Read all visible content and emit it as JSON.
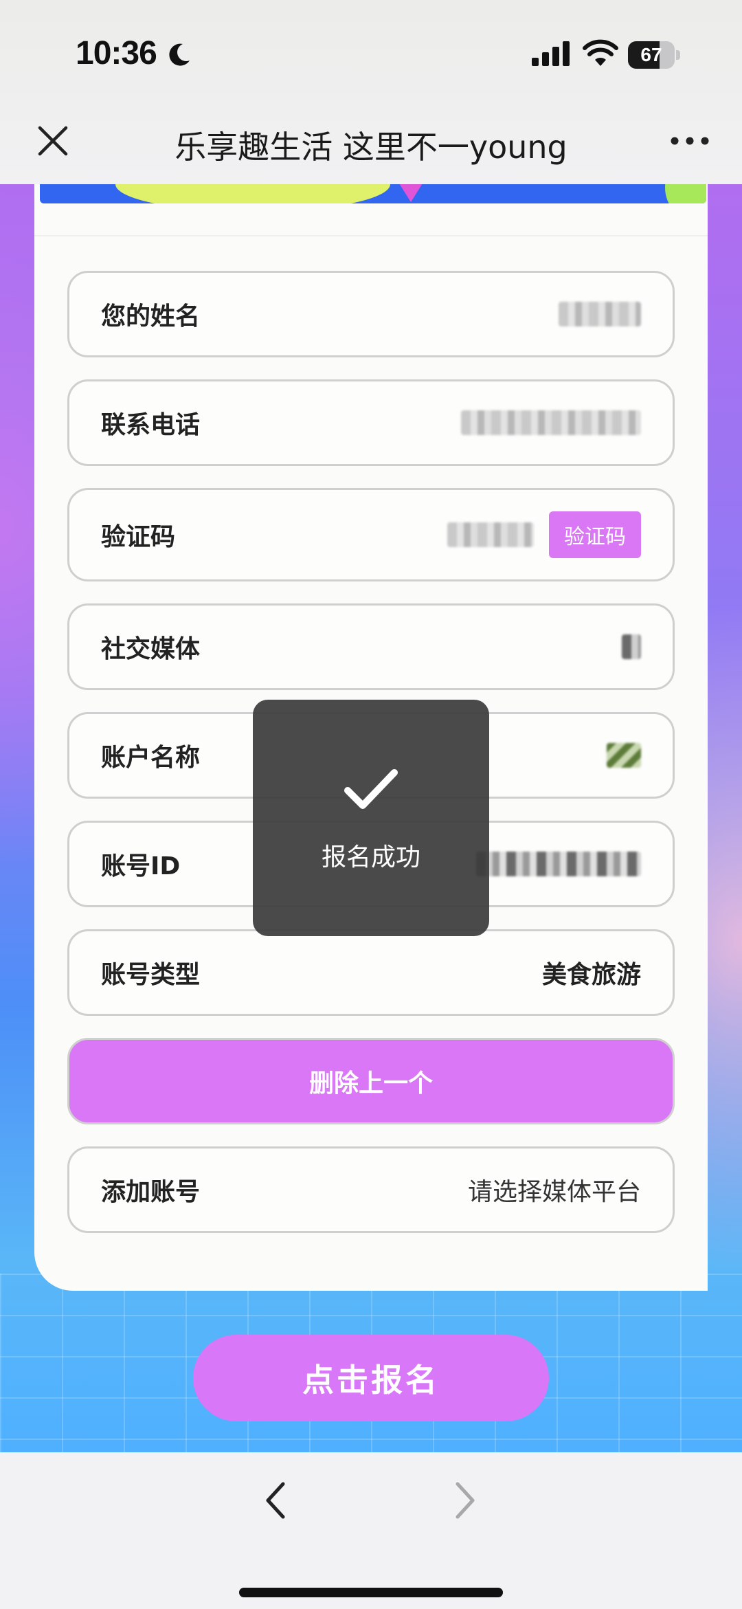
{
  "status_bar": {
    "time": "10:36",
    "battery_level": "67",
    "battery_fraction": 0.67
  },
  "nav": {
    "title": "乐享趣生活 这里不一young"
  },
  "form": {
    "name": {
      "label": "您的姓名"
    },
    "phone": {
      "label": "联系电话"
    },
    "verify": {
      "label": "验证码",
      "button_label": "验证码"
    },
    "social": {
      "label": "社交媒体"
    },
    "account_name": {
      "label": "账户名称"
    },
    "account_id": {
      "label": "账号ID"
    },
    "account_type": {
      "label": "账号类型",
      "value": "美食旅游"
    },
    "delete_label": "删除上一个",
    "add_account": {
      "label": "添加账号",
      "value": "请选择媒体平台"
    }
  },
  "submit_label": "点击报名",
  "toast": {
    "message": "报名成功"
  },
  "colors": {
    "accent": "#d977f7",
    "banner": "#3366f0",
    "toast_bg": "#3c3c3c"
  },
  "icons": [
    "moon-icon",
    "signal-icon",
    "wifi-icon",
    "close-icon",
    "more-icon",
    "check-icon",
    "back-icon",
    "forward-icon"
  ]
}
